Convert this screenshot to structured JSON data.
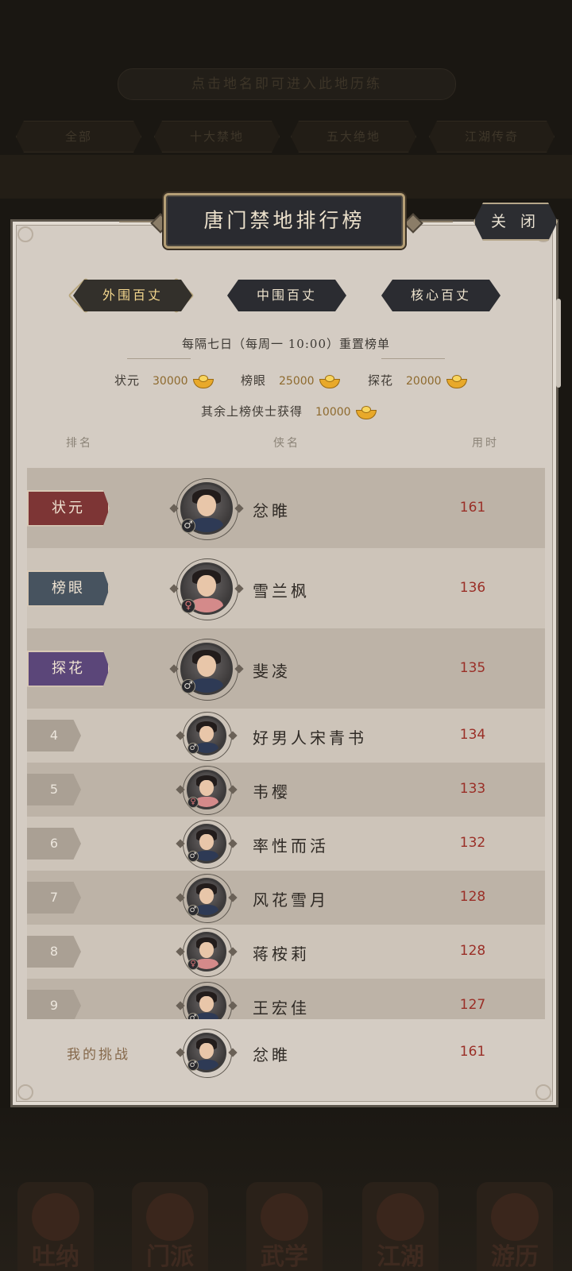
{
  "background": {
    "hint": "点击地名即可进入此地历练",
    "tabs": [
      "全部",
      "十大禁地",
      "五大绝地",
      "江湖传奇"
    ],
    "nav": [
      "吐纳",
      "门派",
      "武学",
      "江湖",
      "游历"
    ]
  },
  "panel": {
    "title": "唐门禁地排行榜",
    "close_label": "关 闭",
    "tabs": [
      {
        "label": "外围百丈",
        "active": true
      },
      {
        "label": "中围百丈",
        "active": false
      },
      {
        "label": "核心百丈",
        "active": false
      }
    ],
    "reset_note": "每隔七日（每周一 10:00）重置榜单",
    "rewards": [
      {
        "title": "状元",
        "amount": "30000"
      },
      {
        "title": "榜眼",
        "amount": "25000"
      },
      {
        "title": "探花",
        "amount": "20000"
      }
    ],
    "others_reward": {
      "label": "其余上榜侠士获得",
      "amount": "10000"
    },
    "columns": {
      "rank": "排名",
      "name": "侠名",
      "time": "用时"
    },
    "rows": [
      {
        "rank": "状元",
        "name": "忿睢",
        "time": "161",
        "gender": "♂",
        "gender_type": "male",
        "badge_color": "#7d3535"
      },
      {
        "rank": "榜眼",
        "name": "雪兰枫",
        "time": "136",
        "gender": "♀",
        "gender_type": "female",
        "badge_color": "#47535f"
      },
      {
        "rank": "探花",
        "name": "斐凌",
        "time": "135",
        "gender": "♂",
        "gender_type": "male",
        "badge_color": "#5b4679"
      },
      {
        "rank": "4",
        "name": "好男人宋青书",
        "time": "134",
        "gender": "♂",
        "gender_type": "male"
      },
      {
        "rank": "5",
        "name": "韦樱",
        "time": "133",
        "gender": "♀",
        "gender_type": "female"
      },
      {
        "rank": "6",
        "name": "率性而活",
        "time": "132",
        "gender": "♂",
        "gender_type": "male"
      },
      {
        "rank": "7",
        "name": "风花雪月",
        "time": "128",
        "gender": "♂",
        "gender_type": "male"
      },
      {
        "rank": "8",
        "name": "蒋桉莉",
        "time": "128",
        "gender": "♀",
        "gender_type": "female"
      },
      {
        "rank": "9",
        "name": "王宏佳",
        "time": "127",
        "gender": "♂",
        "gender_type": "male"
      }
    ],
    "my_challenge": {
      "label": "我的挑战",
      "name": "忿睢",
      "time": "161",
      "gender": "♂",
      "gender_type": "male"
    }
  },
  "colors": {
    "panel_bg": "#d4ccc3",
    "time_red": "#9a2f27",
    "title_bg": "#2a2b30"
  }
}
